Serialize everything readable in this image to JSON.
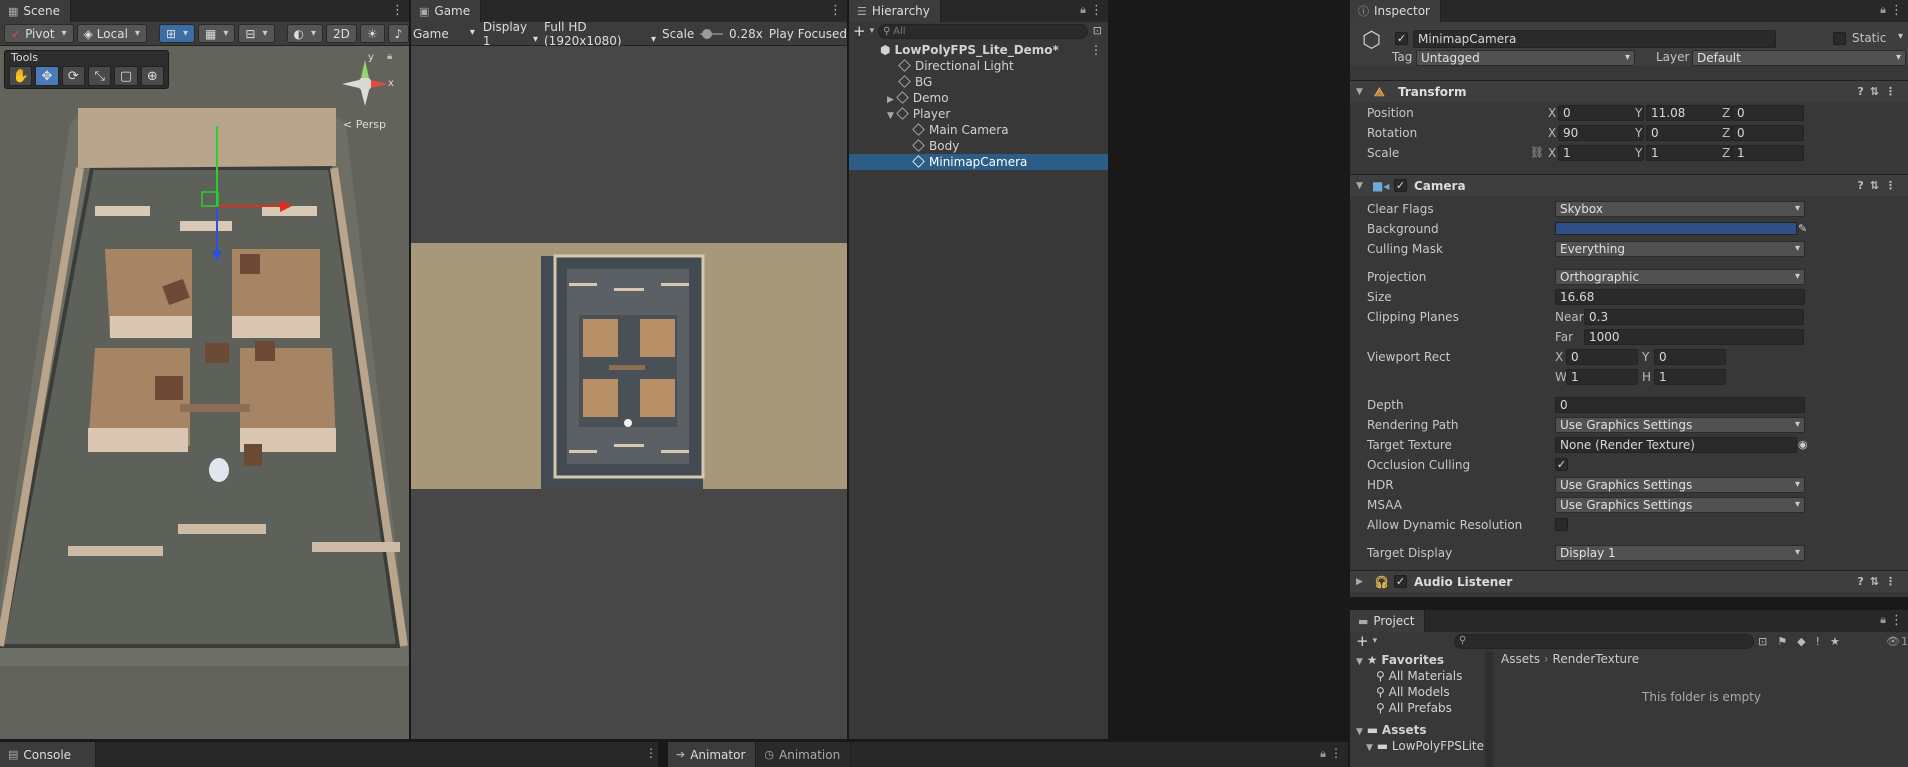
{
  "scene": {
    "tab": "Scene",
    "toolbar": {
      "pivot": "Pivot",
      "local": "Local",
      "mode2d": "2D"
    },
    "tools_title": "Tools",
    "persp_label": "< Persp",
    "gizmo_y": "y",
    "gizmo_x": "x"
  },
  "game": {
    "tab": "Game",
    "toolbar": {
      "mode": "Game",
      "display": "Display 1",
      "resolution": "Full HD (1920x1080)",
      "scale_label": "Scale",
      "scale_value": "0.28x",
      "play_focused": "Play Focused"
    },
    "scale_fraction": 0.12
  },
  "hierarchy": {
    "tab": "Hierarchy",
    "search_placeholder": "All",
    "scene_name": "LowPolyFPS_Lite_Demo*",
    "items": [
      {
        "label": "Directional Light"
      },
      {
        "label": "BG"
      },
      {
        "label": "Demo"
      },
      {
        "label": "Player"
      },
      {
        "label": "Main Camera"
      },
      {
        "label": "Body"
      },
      {
        "label": "MinimapCamera"
      }
    ]
  },
  "inspector": {
    "tab": "Inspector",
    "object_name": "MinimapCamera",
    "static_label": "Static",
    "tag_label": "Tag",
    "tag_value": "Untagged",
    "layer_label": "Layer",
    "layer_value": "Default",
    "transform": {
      "title": "Transform",
      "position_label": "Position",
      "position": {
        "x": "0",
        "y": "11.08",
        "z": "0"
      },
      "rotation_label": "Rotation",
      "rotation": {
        "x": "90",
        "y": "0",
        "z": "0"
      },
      "scale_label": "Scale",
      "scale": {
        "x": "1",
        "y": "1",
        "z": "1"
      }
    },
    "camera": {
      "title": "Camera",
      "clear_flags_label": "Clear Flags",
      "clear_flags": "Skybox",
      "background_label": "Background",
      "background_color": "#2f4f86",
      "culling_mask_label": "Culling Mask",
      "culling_mask": "Everything",
      "projection_label": "Projection",
      "projection": "Orthographic",
      "size_label": "Size",
      "size": "16.68",
      "clipping_label": "Clipping Planes",
      "near_label": "Near",
      "near": "0.3",
      "far_label": "Far",
      "far": "1000",
      "viewport_label": "Viewport Rect",
      "vp_x": "0",
      "vp_y": "0",
      "vp_w": "1",
      "vp_h": "1",
      "depth_label": "Depth",
      "depth": "0",
      "rendering_path_label": "Rendering Path",
      "rendering_path": "Use Graphics Settings",
      "target_texture_label": "Target Texture",
      "target_texture": "None (Render Texture)",
      "occlusion_label": "Occlusion Culling",
      "hdr_label": "HDR",
      "hdr": "Use Graphics Settings",
      "msaa_label": "MSAA",
      "msaa": "Use Graphics Settings",
      "dynres_label": "Allow Dynamic Resolution",
      "target_display_label": "Target Display",
      "target_display": "Display 1"
    },
    "audio_listener": {
      "title": "Audio Listener"
    }
  },
  "project": {
    "tab": "Project",
    "favorites_label": "Favorites",
    "favorites": [
      {
        "label": "All Materials"
      },
      {
        "label": "All Models"
      },
      {
        "label": "All Prefabs"
      }
    ],
    "assets_label": "Assets",
    "asset_folder": "LowPolyFPSLite",
    "breadcrumb_root": "Assets",
    "breadcrumb_leaf": "RenderTexture",
    "empty_text": "This folder is empty",
    "count": "1"
  },
  "bottom": {
    "console": "Console",
    "animator": "Animator",
    "animation": "Animation"
  }
}
